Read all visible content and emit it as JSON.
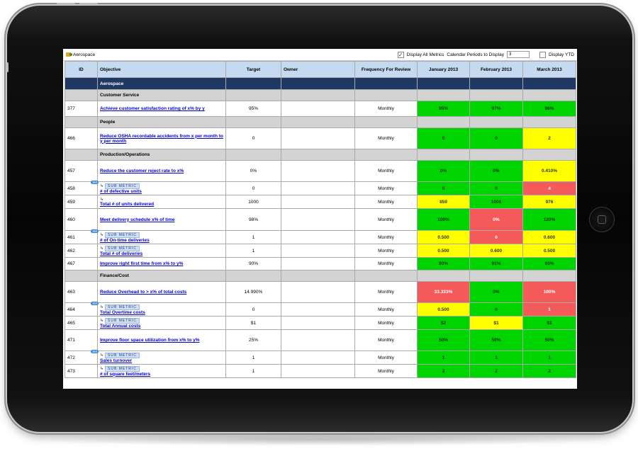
{
  "app": {
    "context_name": "Aerospace",
    "display_all_metrics_label": "Display All Metrics",
    "display_all_metrics_checked": true,
    "calendar_periods_label": "Calendar Periods to Display",
    "calendar_periods_value": "3",
    "display_ytd_label": "Display YTD",
    "display_ytd_checked": false
  },
  "table": {
    "headers": {
      "id": "ID",
      "objective": "Objective",
      "target": "Target",
      "owner": "Owner",
      "frequency": "Frequency For Review",
      "m1": "January 2013",
      "m2": "February 2013",
      "m3": "March 2013"
    },
    "top_group": "Aerospace",
    "sub_metric_tag": "SUB METRIC",
    "sm_badge": "SM",
    "groups": [
      {
        "name": "Customer Service"
      },
      {
        "name": "People"
      },
      {
        "name": "Production/Operations"
      },
      {
        "name": "Finance/Cost"
      }
    ],
    "rows": [
      {
        "id": "377",
        "objective": "Achieve customer satisfaction rating of x% by y",
        "target": "95%",
        "freq": "Monthly",
        "v1": "95%",
        "v2": "97%",
        "v3": "96%"
      },
      {
        "id": "466",
        "objective": "Reduce OSHA recordable accidents from x per month to y per month",
        "target": "0",
        "freq": "Monthly",
        "v1": "0",
        "v2": "0",
        "v3": "2"
      },
      {
        "id": "457",
        "objective": "Reduce the customer reject rate to x%",
        "target": "0%",
        "freq": "Monthly",
        "v1": "0%",
        "v2": "0%",
        "v3": "0.410%"
      },
      {
        "id": "458",
        "objective": "# of defective units",
        "target": "0",
        "freq": "Monthly",
        "v1": "0",
        "v2": "0",
        "v3": "4"
      },
      {
        "id": "459",
        "objective": "Total # of units delivered",
        "target": "1000",
        "freq": "Monthly",
        "v1": "859",
        "v2": "1000",
        "v3": "976"
      },
      {
        "id": "460",
        "objective": "Meet delivery schedule x% of time",
        "target": "98%",
        "freq": "Monthly",
        "v1": "100%",
        "v2": "0%",
        "v3": "120%"
      },
      {
        "id": "461",
        "objective": "# of On-time deliveries",
        "target": "1",
        "freq": "Monthly",
        "v1": "0.500",
        "v2": "0",
        "v3": "0.600"
      },
      {
        "id": "462",
        "objective": "Total # of deliveries",
        "target": "1",
        "freq": "Monthly",
        "v1": "0.500",
        "v2": "0.600",
        "v3": "0.500"
      },
      {
        "id": "467",
        "objective": "Improve right first time from x% to y%",
        "target": "90%",
        "freq": "Monthly",
        "v1": "90%",
        "v2": "91%",
        "v3": "93%"
      },
      {
        "id": "463",
        "objective": "Reduce Overhead to > x% of total costs",
        "target": "14.990%",
        "freq": "Monthly",
        "v1": "33.333%",
        "v2": "0%",
        "v3": "100%"
      },
      {
        "id": "464",
        "objective": "Total Overtime costs",
        "target": "0",
        "freq": "Monthly",
        "v1": "0.500",
        "v2": "0",
        "v3": "1"
      },
      {
        "id": "465",
        "objective": "Total Annual costs",
        "target": "$1",
        "freq": "Monthly",
        "v1": "$2",
        "v2": "$1",
        "v3": "$1"
      },
      {
        "id": "471",
        "objective": "Improve floor space utilization from x% to y%",
        "target": "25%",
        "freq": "Monthly",
        "v1": "50%",
        "v2": "50%",
        "v3": "50%"
      },
      {
        "id": "472",
        "objective": "Sales turnover",
        "target": "1",
        "freq": "Monthly",
        "v1": "1",
        "v2": "1",
        "v3": "1"
      },
      {
        "id": "473",
        "objective": "# of square feet/meters",
        "target": "1",
        "freq": "Monthly",
        "v1": "2",
        "v2": "2",
        "v3": "2"
      }
    ]
  },
  "status_colors": {
    "green": "#00d400",
    "yellow": "#ffff00",
    "red": "#f55a5a",
    "header": "#c5d9f1",
    "group_top": "#1f3864"
  }
}
